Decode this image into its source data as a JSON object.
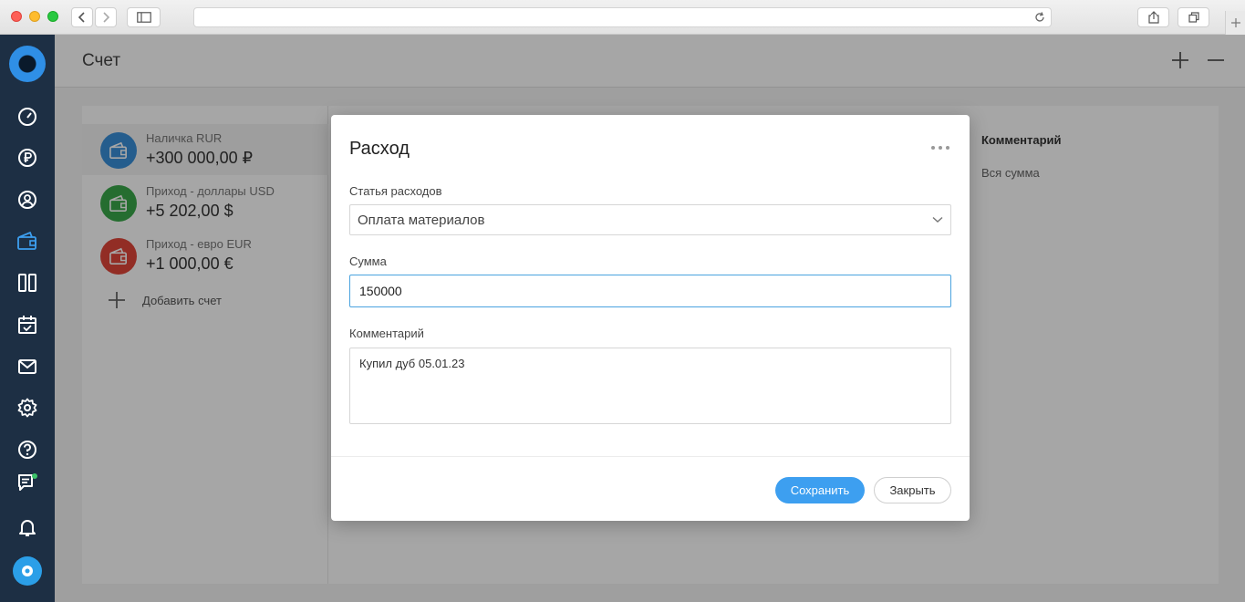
{
  "browser": {
    "url": "",
    "icons": [
      "back-icon",
      "forward-icon",
      "sidebar-icon",
      "reload-icon",
      "share-icon",
      "tabs-icon",
      "new-tab-icon"
    ]
  },
  "sidebar": {
    "items": [
      {
        "name": "dashboard",
        "icon": "speedometer-icon"
      },
      {
        "name": "finance",
        "icon": "ruble-icon"
      },
      {
        "name": "profile",
        "icon": "user-icon"
      },
      {
        "name": "accounts",
        "icon": "wallet-icon",
        "active": true
      },
      {
        "name": "boards",
        "icon": "columns-icon"
      },
      {
        "name": "calendar",
        "icon": "calendar-icon"
      },
      {
        "name": "mail",
        "icon": "mail-icon"
      },
      {
        "name": "settings",
        "icon": "gear-icon"
      },
      {
        "name": "help",
        "icon": "question-icon"
      },
      {
        "name": "chat",
        "icon": "chat-icon"
      },
      {
        "name": "notifications",
        "icon": "bell-icon"
      }
    ],
    "colors": {
      "bg": "#1d2f44",
      "active": "#3d9ff0"
    }
  },
  "header": {
    "title": "Счет"
  },
  "accounts": [
    {
      "name": "Наличка RUR",
      "amount": "+300 000,00 ₽",
      "color": "#3a8fd9"
    },
    {
      "name": "Приход - доллары USD",
      "amount": "+5 202,00 $",
      "color": "#3aa84a"
    },
    {
      "name": "Приход - евро EUR",
      "amount": "+1 000,00 €",
      "color": "#e0463a"
    }
  ],
  "add_account_label": "Добавить счет",
  "right_column": {
    "header": "Комментарий",
    "value": "Вся сумма"
  },
  "modal": {
    "title": "Расход",
    "category_label": "Статья расходов",
    "category_value": "Оплата материалов",
    "amount_label": "Сумма",
    "amount_value": "150000",
    "comment_label": "Комментарий",
    "comment_value": "Купил дуб 05.01.23",
    "save_label": "Сохранить",
    "close_label": "Закрыть"
  }
}
